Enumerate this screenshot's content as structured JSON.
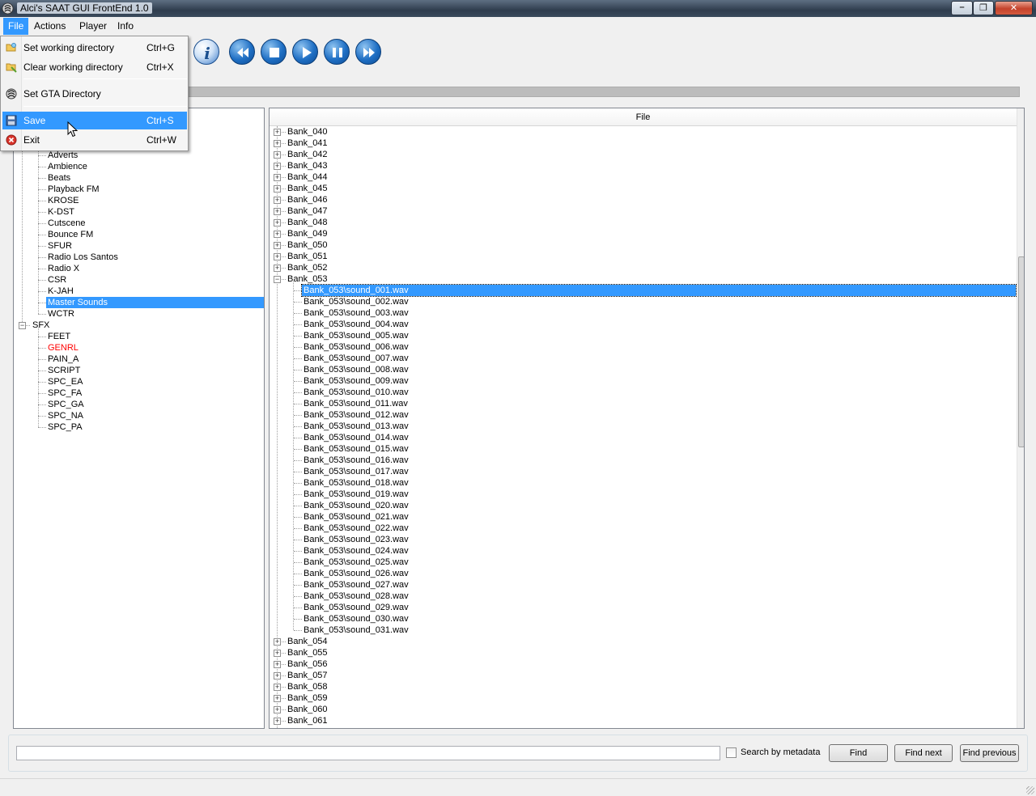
{
  "window": {
    "title": "Alci's SAAT GUI FrontEnd 1.0"
  },
  "menubar": {
    "items": [
      "File",
      "Actions",
      "Player",
      "Info"
    ],
    "active": "File"
  },
  "file_menu": {
    "items": [
      {
        "label": "Set working directory",
        "shortcut": "Ctrl+G",
        "icon": "folder-open-icon"
      },
      {
        "label": "Clear working directory",
        "shortcut": "Ctrl+X",
        "icon": "folder-clear-icon"
      },
      {
        "label": "Set GTA Directory",
        "shortcut": "",
        "icon": "gta-icon"
      },
      {
        "label": "Save",
        "shortcut": "Ctrl+S",
        "icon": "floppy-save-icon",
        "highlighted": true
      },
      {
        "label": "Exit",
        "shortcut": "Ctrl+W",
        "icon": "exit-icon"
      }
    ]
  },
  "toolbar": {
    "buttons": [
      "info-icon",
      "rewind-icon",
      "stop-icon",
      "play-icon",
      "pause-icon",
      "fast-forward-icon"
    ]
  },
  "left_tree": {
    "items": [
      {
        "label": "Adverts"
      },
      {
        "label": "Ambience"
      },
      {
        "label": "Beats"
      },
      {
        "label": "Playback FM"
      },
      {
        "label": "KROSE"
      },
      {
        "label": "K-DST"
      },
      {
        "label": "Cutscene"
      },
      {
        "label": "Bounce FM"
      },
      {
        "label": "SFUR"
      },
      {
        "label": "Radio Los Santos"
      },
      {
        "label": "Radio X"
      },
      {
        "label": "CSR"
      },
      {
        "label": "K-JAH"
      },
      {
        "label": "Master Sounds",
        "selected": true
      },
      {
        "label": "WCTR"
      }
    ],
    "sfx_label": "SFX",
    "sfx_items": [
      {
        "label": "FEET"
      },
      {
        "label": "GENRL",
        "color": "#ff0000"
      },
      {
        "label": "PAIN_A"
      },
      {
        "label": "SCRIPT"
      },
      {
        "label": "SPC_EA"
      },
      {
        "label": "SPC_FA"
      },
      {
        "label": "SPC_GA"
      },
      {
        "label": "SPC_NA"
      },
      {
        "label": "SPC_PA"
      }
    ]
  },
  "file_tree": {
    "column_header": "File",
    "banks_before": [
      "Bank_040",
      "Bank_041",
      "Bank_042",
      "Bank_043",
      "Bank_044",
      "Bank_045",
      "Bank_046",
      "Bank_047",
      "Bank_048",
      "Bank_049",
      "Bank_050",
      "Bank_051",
      "Bank_052"
    ],
    "expanded_bank": "Bank_053",
    "files": [
      "Bank_053\\sound_001.wav",
      "Bank_053\\sound_002.wav",
      "Bank_053\\sound_003.wav",
      "Bank_053\\sound_004.wav",
      "Bank_053\\sound_005.wav",
      "Bank_053\\sound_006.wav",
      "Bank_053\\sound_007.wav",
      "Bank_053\\sound_008.wav",
      "Bank_053\\sound_009.wav",
      "Bank_053\\sound_010.wav",
      "Bank_053\\sound_011.wav",
      "Bank_053\\sound_012.wav",
      "Bank_053\\sound_013.wav",
      "Bank_053\\sound_014.wav",
      "Bank_053\\sound_015.wav",
      "Bank_053\\sound_016.wav",
      "Bank_053\\sound_017.wav",
      "Bank_053\\sound_018.wav",
      "Bank_053\\sound_019.wav",
      "Bank_053\\sound_020.wav",
      "Bank_053\\sound_021.wav",
      "Bank_053\\sound_022.wav",
      "Bank_053\\sound_023.wav",
      "Bank_053\\sound_024.wav",
      "Bank_053\\sound_025.wav",
      "Bank_053\\sound_026.wav",
      "Bank_053\\sound_027.wav",
      "Bank_053\\sound_028.wav",
      "Bank_053\\sound_029.wav",
      "Bank_053\\sound_030.wav",
      "Bank_053\\sound_031.wav"
    ],
    "selected_file_index": 0,
    "banks_after": [
      "Bank_054",
      "Bank_055",
      "Bank_056",
      "Bank_057",
      "Bank_058",
      "Bank_059",
      "Bank_060",
      "Bank_061"
    ]
  },
  "search": {
    "value": "",
    "checkbox_label": "Search by metadata",
    "checkbox_checked": false,
    "find_label": "Find",
    "find_next_label": "Find next",
    "find_previous_label": "Find previous"
  },
  "colors": {
    "selection": "#3399ff",
    "highlight_text": "#ff0000"
  }
}
